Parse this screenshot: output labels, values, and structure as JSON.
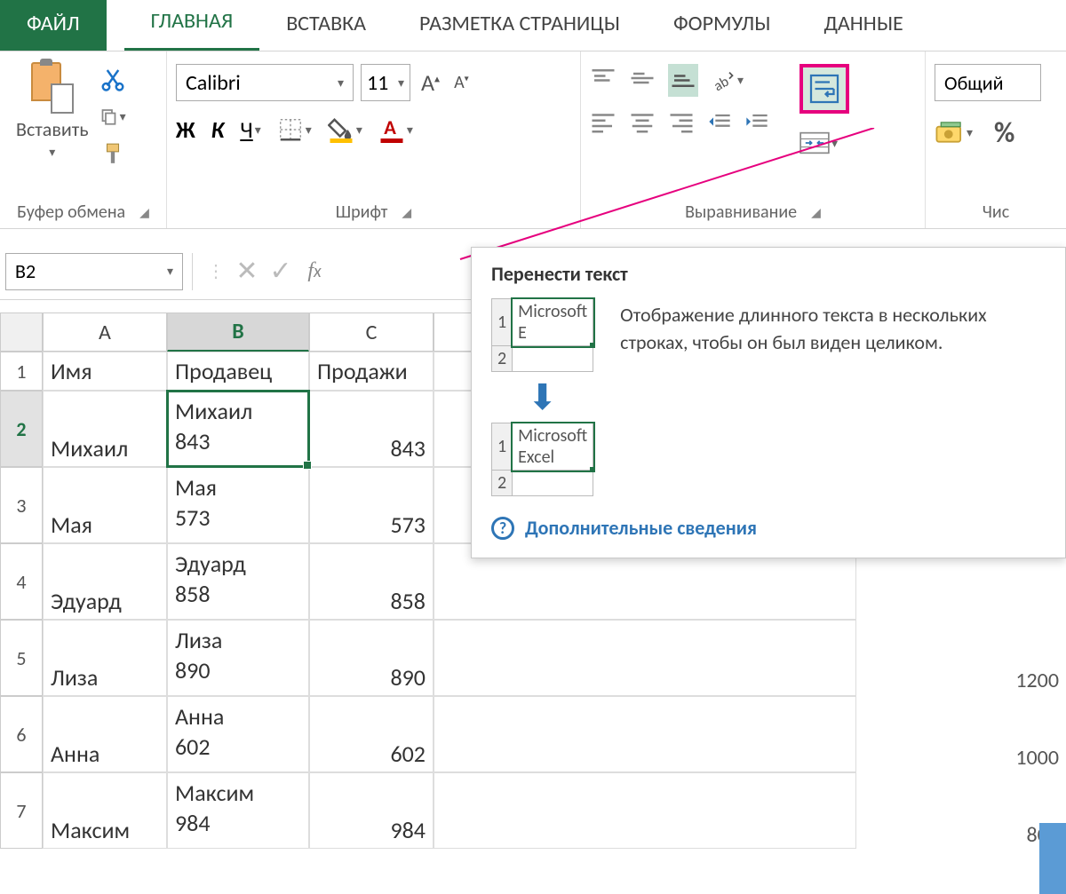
{
  "tabs": {
    "file": "ФАЙЛ",
    "home": "ГЛАВНАЯ",
    "insert": "ВСТАВКА",
    "layout": "РАЗМЕТКА СТРАНИЦЫ",
    "formulas": "ФОРМУЛЫ",
    "data": "ДАННЫЕ"
  },
  "ribbon": {
    "clipboard": {
      "paste": "Вставить",
      "label": "Буфер обмена"
    },
    "font": {
      "name": "Calibri",
      "size": "11",
      "bold": "Ж",
      "italic": "К",
      "underline": "Ч",
      "label": "Шрифт"
    },
    "align": {
      "label": "Выравнивание"
    },
    "number": {
      "format": "Общий",
      "pct": "%",
      "label": "Чис"
    }
  },
  "namebox": "B2",
  "tooltip": {
    "title": "Перенести текст",
    "demo1": "Microsoft E",
    "demo2a": "Microsoft",
    "demo2b": "Excel",
    "desc": "Отображение длинного текста в нескольких строках, чтобы он был виден целиком.",
    "more": "Дополнительные сведения"
  },
  "columns": [
    "A",
    "B",
    "C"
  ],
  "headers": {
    "a": "Имя",
    "b": "Продавец",
    "c": "Продажи"
  },
  "rows": [
    {
      "a": "Михаил",
      "b1": "Михаил",
      "b2": "843",
      "c": "843"
    },
    {
      "a": "Мая",
      "b1": "Мая",
      "b2": "573",
      "c": "573"
    },
    {
      "a": "Эдуард",
      "b1": "Эдуард",
      "b2": "858",
      "c": "858"
    },
    {
      "a": "Лиза",
      "b1": "Лиза",
      "b2": "890",
      "c": "890"
    },
    {
      "a": "Анна",
      "b1": "Анна",
      "b2": "602",
      "c": "602"
    },
    {
      "a": "Максим",
      "b1": "Максим",
      "b2": "984",
      "c": "984"
    }
  ],
  "chart_axis": [
    "1200",
    "1000",
    "800"
  ]
}
